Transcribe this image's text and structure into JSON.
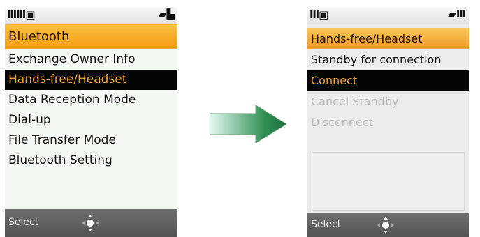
{
  "screens": [
    {
      "status": {
        "left": "ⅢⅢ▣",
        "right": "▰▙"
      },
      "title": "Bluetooth",
      "menu": [
        {
          "label": "Exchange Owner Info",
          "state": "normal"
        },
        {
          "label": "Hands-free/Headset",
          "state": "selected"
        },
        {
          "label": "Data Reception Mode",
          "state": "normal"
        },
        {
          "label": "Dial-up",
          "state": "normal"
        },
        {
          "label": "File Transfer Mode",
          "state": "normal"
        },
        {
          "label": "Bluetooth Setting",
          "state": "normal"
        }
      ],
      "soft_key": "Select"
    },
    {
      "status": {
        "left": "Ⅲ▣",
        "right": "▰Ⅲ"
      },
      "title": "Hands-free/Headset",
      "menu": [
        {
          "label": "Standby for connection",
          "state": "normal"
        },
        {
          "label": "Connect",
          "state": "selected"
        },
        {
          "label": "Cancel Standby",
          "state": "disabled"
        },
        {
          "label": "Disconnect",
          "state": "disabled"
        }
      ],
      "soft_key": "Select"
    }
  ],
  "transition_arrow": {
    "colors": [
      "#e4faf4",
      "#2f8f53",
      "#1f6d3b"
    ]
  }
}
